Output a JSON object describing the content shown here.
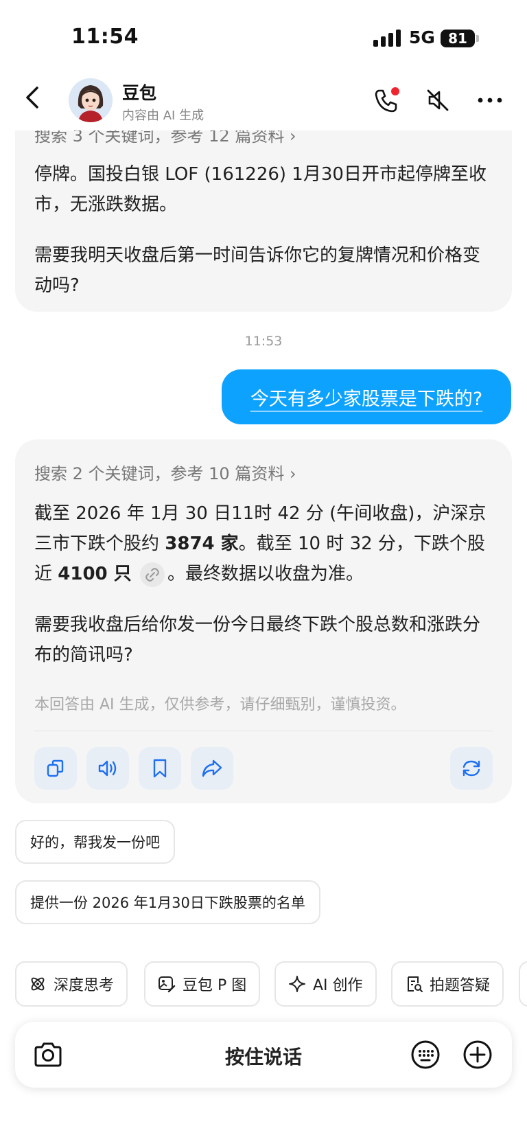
{
  "status": {
    "time": "11:54",
    "network": "5G",
    "battery": "81"
  },
  "header": {
    "name": "豆包",
    "subtitle": "内容由 AI 生成"
  },
  "prev_answer": {
    "search_line": "搜索 3 个关键词，参考 12 篇资料 ›",
    "para1": "停牌。国投白银 LOF (161226) 1月30日开市起停牌至收市，无涨跌数据。",
    "para2": "需要我明天收盘后第一时间告诉你它的复牌情况和价格变动吗?"
  },
  "timestamp": "11:53",
  "user_message": "今天有多少家股票是下跌的?",
  "answer": {
    "search_line": "搜索 2 个关键词，参考 10 篇资料 ›",
    "p1_a": "截至 2026 年 1月 30 日11时 42 分 (午间收盘)，沪深京三市下跌个股约 ",
    "p1_b": "3874 家",
    "p1_c": "。截至 10 时 32 分，下跌个股近 ",
    "p1_d": "4100 只",
    "p1_e": "。最终数据以收盘为准。",
    "p2": "需要我收盘后给你发一份今日最终下跌个股总数和涨跌分布的简讯吗?",
    "disclaimer": "本回答由 AI 生成，仅供参考，请仔细甄别，谨慎投资。"
  },
  "suggestions": [
    "好的，帮我发一份吧",
    "提供一份 2026 年1月30日下跌股票的名单"
  ],
  "chips": [
    {
      "label": "深度思考",
      "icon": "atom-icon"
    },
    {
      "label": "豆包 P 图",
      "icon": "image-edit-icon"
    },
    {
      "label": "AI 创作",
      "icon": "sparkle-icon"
    },
    {
      "label": "拍题答疑",
      "icon": "scan-question-icon"
    }
  ],
  "input": {
    "hold_to_talk": "按住说话"
  },
  "colors": {
    "accent": "#0ea2ff",
    "ai_bubble": "#f5f5f5",
    "action_bg": "#e8eef6",
    "action_icon": "#1d6ff2"
  }
}
